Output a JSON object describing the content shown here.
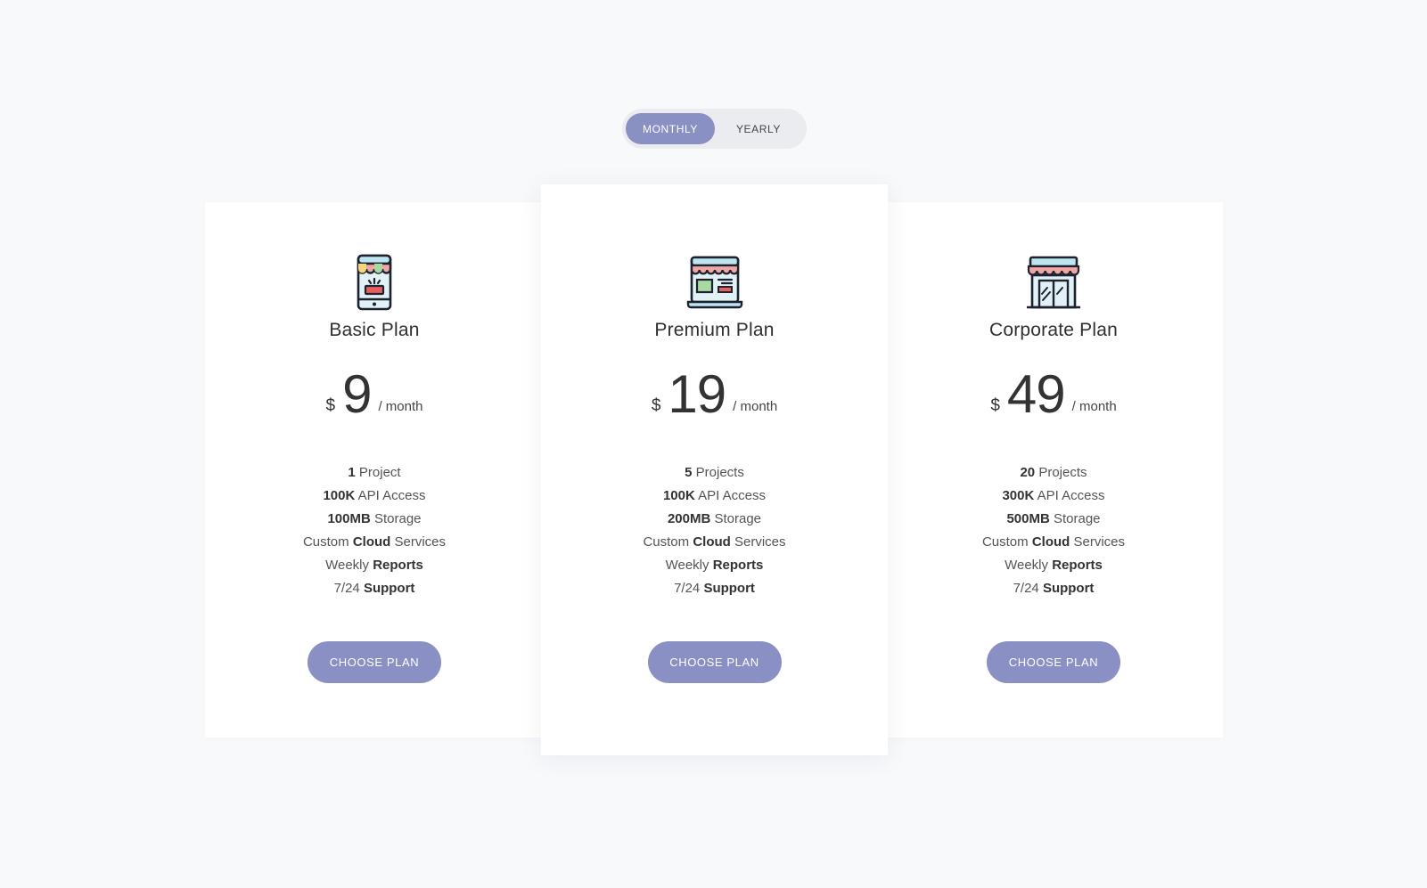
{
  "billing_toggle": {
    "monthly": "MONTHLY",
    "yearly": "YEARLY",
    "active": "monthly"
  },
  "plans": [
    {
      "name": "Basic Plan",
      "icon": "mobile-shop-icon",
      "currency": "$",
      "price": "9",
      "period": "/ month",
      "features": [
        {
          "bold": "1",
          "text": "Project",
          "bold_first": true
        },
        {
          "bold": "100K",
          "text": "API Access",
          "bold_first": true
        },
        {
          "bold": "100MB",
          "text": "Storage",
          "bold_first": true
        },
        {
          "pre": "Custom",
          "bold": "Cloud",
          "post": "Services"
        },
        {
          "pre": "Weekly",
          "bold": "Reports",
          "post": ""
        },
        {
          "pre": "7/24",
          "bold": "Support",
          "post": ""
        }
      ],
      "cta": "CHOOSE PLAN"
    },
    {
      "name": "Premium Plan",
      "icon": "laptop-shop-icon",
      "currency": "$",
      "price": "19",
      "period": "/ month",
      "features": [
        {
          "bold": "5",
          "text": "Projects",
          "bold_first": true
        },
        {
          "bold": "100K",
          "text": "API Access",
          "bold_first": true
        },
        {
          "bold": "200MB",
          "text": "Storage",
          "bold_first": true
        },
        {
          "pre": "Custom",
          "bold": "Cloud",
          "post": "Services"
        },
        {
          "pre": "Weekly",
          "bold": "Reports",
          "post": ""
        },
        {
          "pre": "7/24",
          "bold": "Support",
          "post": ""
        }
      ],
      "cta": "CHOOSE PLAN"
    },
    {
      "name": "Corporate Plan",
      "icon": "storefront-icon",
      "currency": "$",
      "price": "49",
      "period": "/ month",
      "features": [
        {
          "bold": "20",
          "text": "Projects",
          "bold_first": true
        },
        {
          "bold": "300K",
          "text": "API Access",
          "bold_first": true
        },
        {
          "bold": "500MB",
          "text": "Storage",
          "bold_first": true
        },
        {
          "pre": "Custom",
          "bold": "Cloud",
          "post": "Services"
        },
        {
          "pre": "Weekly",
          "bold": "Reports",
          "post": ""
        },
        {
          "pre": "7/24",
          "bold": "Support",
          "post": ""
        }
      ],
      "cta": "CHOOSE PLAN"
    }
  ],
  "colors": {
    "accent": "#8a8fc4",
    "background": "#f8f9fb",
    "card": "#ffffff",
    "toggle_track": "#ebecef"
  }
}
